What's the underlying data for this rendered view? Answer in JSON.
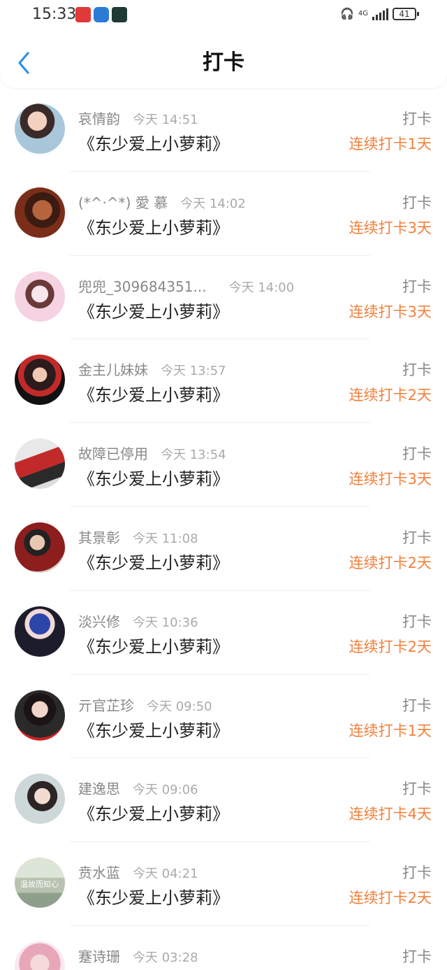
{
  "status_bar": {
    "time": "15:33",
    "battery": "41",
    "network": "4G"
  },
  "header": {
    "title": "打卡"
  },
  "entries": [
    {
      "name": "哀情韵",
      "time": "今天 14:51",
      "book": "《东少爱上小萝莉》",
      "action": "打卡",
      "streak": "连续打卡1天"
    },
    {
      "name": "(*^·^*) 愛 慕",
      "time": "今天 14:02",
      "book": "《东少爱上小萝莉》",
      "action": "打卡",
      "streak": "连续打卡3天"
    },
    {
      "name": "兜兜_309684351...",
      "time": "今天 14:00",
      "book": "《东少爱上小萝莉》",
      "action": "打卡",
      "streak": "连续打卡3天"
    },
    {
      "name": "金主儿妹妹",
      "time": "今天 13:57",
      "book": "《东少爱上小萝莉》",
      "action": "打卡",
      "streak": "连续打卡2天"
    },
    {
      "name": "故障已停用",
      "time": "今天 13:54",
      "book": "《东少爱上小萝莉》",
      "action": "打卡",
      "streak": "连续打卡3天"
    },
    {
      "name": "其景彰",
      "time": "今天 11:08",
      "book": "《东少爱上小萝莉》",
      "action": "打卡",
      "streak": "连续打卡2天"
    },
    {
      "name": "淡兴修",
      "time": "今天 10:36",
      "book": "《东少爱上小萝莉》",
      "action": "打卡",
      "streak": "连续打卡2天"
    },
    {
      "name": "亓官芷珍",
      "time": "今天 09:50",
      "book": "《东少爱上小萝莉》",
      "action": "打卡",
      "streak": "连续打卡1天"
    },
    {
      "name": "建逸思",
      "time": "今天 09:06",
      "book": "《东少爱上小萝莉》",
      "action": "打卡",
      "streak": "连续打卡4天"
    },
    {
      "name": "贲水蓝",
      "time": "今天 04:21",
      "book": "《东少爱上小萝莉》",
      "action": "打卡",
      "streak": "连续打卡2天"
    },
    {
      "name": "蹇诗珊",
      "time": "今天 03:28",
      "book": "",
      "action": "打卡",
      "streak": ""
    }
  ],
  "avatar_overlay_text": "温故而知心",
  "colors": {
    "accent_back": "#2f8fe6",
    "streak": "#f0803c",
    "name": "#888888",
    "time": "#aaaaaa"
  }
}
